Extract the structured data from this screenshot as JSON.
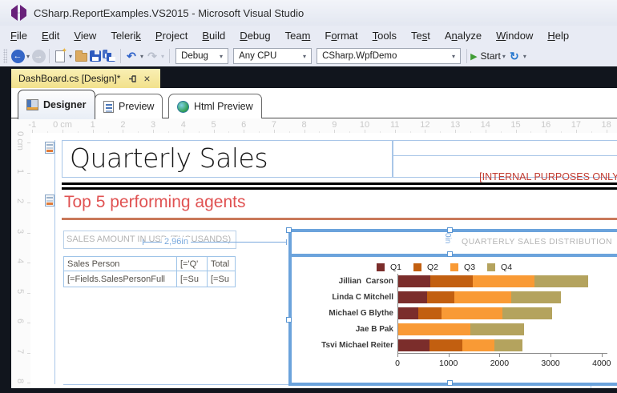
{
  "window": {
    "title": "CSharp.ReportExamples.VS2015 - Microsoft Visual Studio"
  },
  "menu": {
    "items": [
      {
        "label": "File",
        "accel": 0
      },
      {
        "label": "Edit",
        "accel": 0
      },
      {
        "label": "View",
        "accel": 0
      },
      {
        "label": "Telerik",
        "accel": 6
      },
      {
        "label": "Project",
        "accel": 0
      },
      {
        "label": "Build",
        "accel": 0
      },
      {
        "label": "Debug",
        "accel": 0
      },
      {
        "label": "Team",
        "accel": 3
      },
      {
        "label": "Format",
        "accel": 1
      },
      {
        "label": "Tools",
        "accel": 0
      },
      {
        "label": "Test",
        "accel": 2
      },
      {
        "label": "Analyze",
        "accel": 1
      },
      {
        "label": "Window",
        "accel": 0
      },
      {
        "label": "Help",
        "accel": 0
      }
    ]
  },
  "toolbar": {
    "configuration_value": "Debug",
    "platform_value": "Any CPU",
    "startup_project_value": "CSharp.WpfDemo",
    "start_label": "Start"
  },
  "doc_tab": {
    "title": "DashBoard.cs [Design]*"
  },
  "view_tabs": [
    {
      "label": "Designer"
    },
    {
      "label": "Preview"
    },
    {
      "label": "Html Preview"
    }
  ],
  "ruler": {
    "horizontal_labels": [
      "-1",
      "0 cm",
      "1",
      "2",
      "3",
      "4",
      "5",
      "6",
      "7",
      "8",
      "9",
      "10",
      "11",
      "12",
      "13",
      "14",
      "15",
      "16",
      "17",
      "18"
    ],
    "vertical_labels": [
      "0 cm",
      "1",
      "2",
      "3",
      "4",
      "5",
      "6",
      "7",
      "8"
    ]
  },
  "report": {
    "title_text": "Quarterly Sales",
    "internal_note": "[INTERNAL PURPOSES ONLY]",
    "section_heading": "Top 5 performing agents",
    "table_caption": "SALES AMOUNT IN USD (THOUSANDS)",
    "table": {
      "headers": [
        "Sales Person",
        "[='Q'",
        "Total"
      ],
      "rows": [
        [
          "[=Fields.SalesPersonFull",
          "[=Su",
          "[=Su"
        ]
      ]
    },
    "dim_width_label": "2,96in",
    "dim_top_label": "0in"
  },
  "chart_data": {
    "type": "bar",
    "orientation": "horizontal",
    "stacked": true,
    "title": "QUARTERLY SALES DISTRIBUTION",
    "legend_position": "top",
    "categories": [
      "Jillian  Carson",
      "Linda C Mitchell",
      "Michael G Blythe",
      "Jae B Pak",
      "Tsvi Michael Reiter"
    ],
    "series": [
      {
        "name": "Q1",
        "color": "#7b2d2b",
        "values": [
          630,
          570,
          395,
          0,
          610
        ]
      },
      {
        "name": "Q2",
        "color": "#c25f10",
        "values": [
          830,
          530,
          450,
          0,
          645
        ]
      },
      {
        "name": "Q3",
        "color": "#f99a35",
        "values": [
          1215,
          1120,
          1200,
          1410,
          635
        ]
      },
      {
        "name": "Q4",
        "color": "#b4a35e",
        "values": [
          1050,
          965,
          970,
          1060,
          545
        ]
      }
    ],
    "xlim": [
      0,
      4000
    ],
    "x_ticks": [
      0,
      1000,
      2000,
      3000,
      4000
    ],
    "grid": false
  },
  "icons": {
    "back_glyph": "←",
    "forward_glyph": "→",
    "dropdown_glyph": "▾",
    "undo_glyph": "↶",
    "redo_glyph": "↷",
    "refresh_glyph": "↻",
    "play_glyph": "▶",
    "close_glyph": "×"
  },
  "colors": {
    "selection_blue": "#6ba3dc",
    "item_border_blue": "#a9c6e8",
    "dimension_blue": "#7aa9dd",
    "heading_red": "#e05252",
    "note_red": "#c23b30",
    "rule_brown": "#c9795a",
    "muted_text": "#b3b3b3",
    "chrome_dark": "#11151d",
    "active_tab_yellow": "#f2e18c",
    "logo_purple": "#68217a"
  }
}
